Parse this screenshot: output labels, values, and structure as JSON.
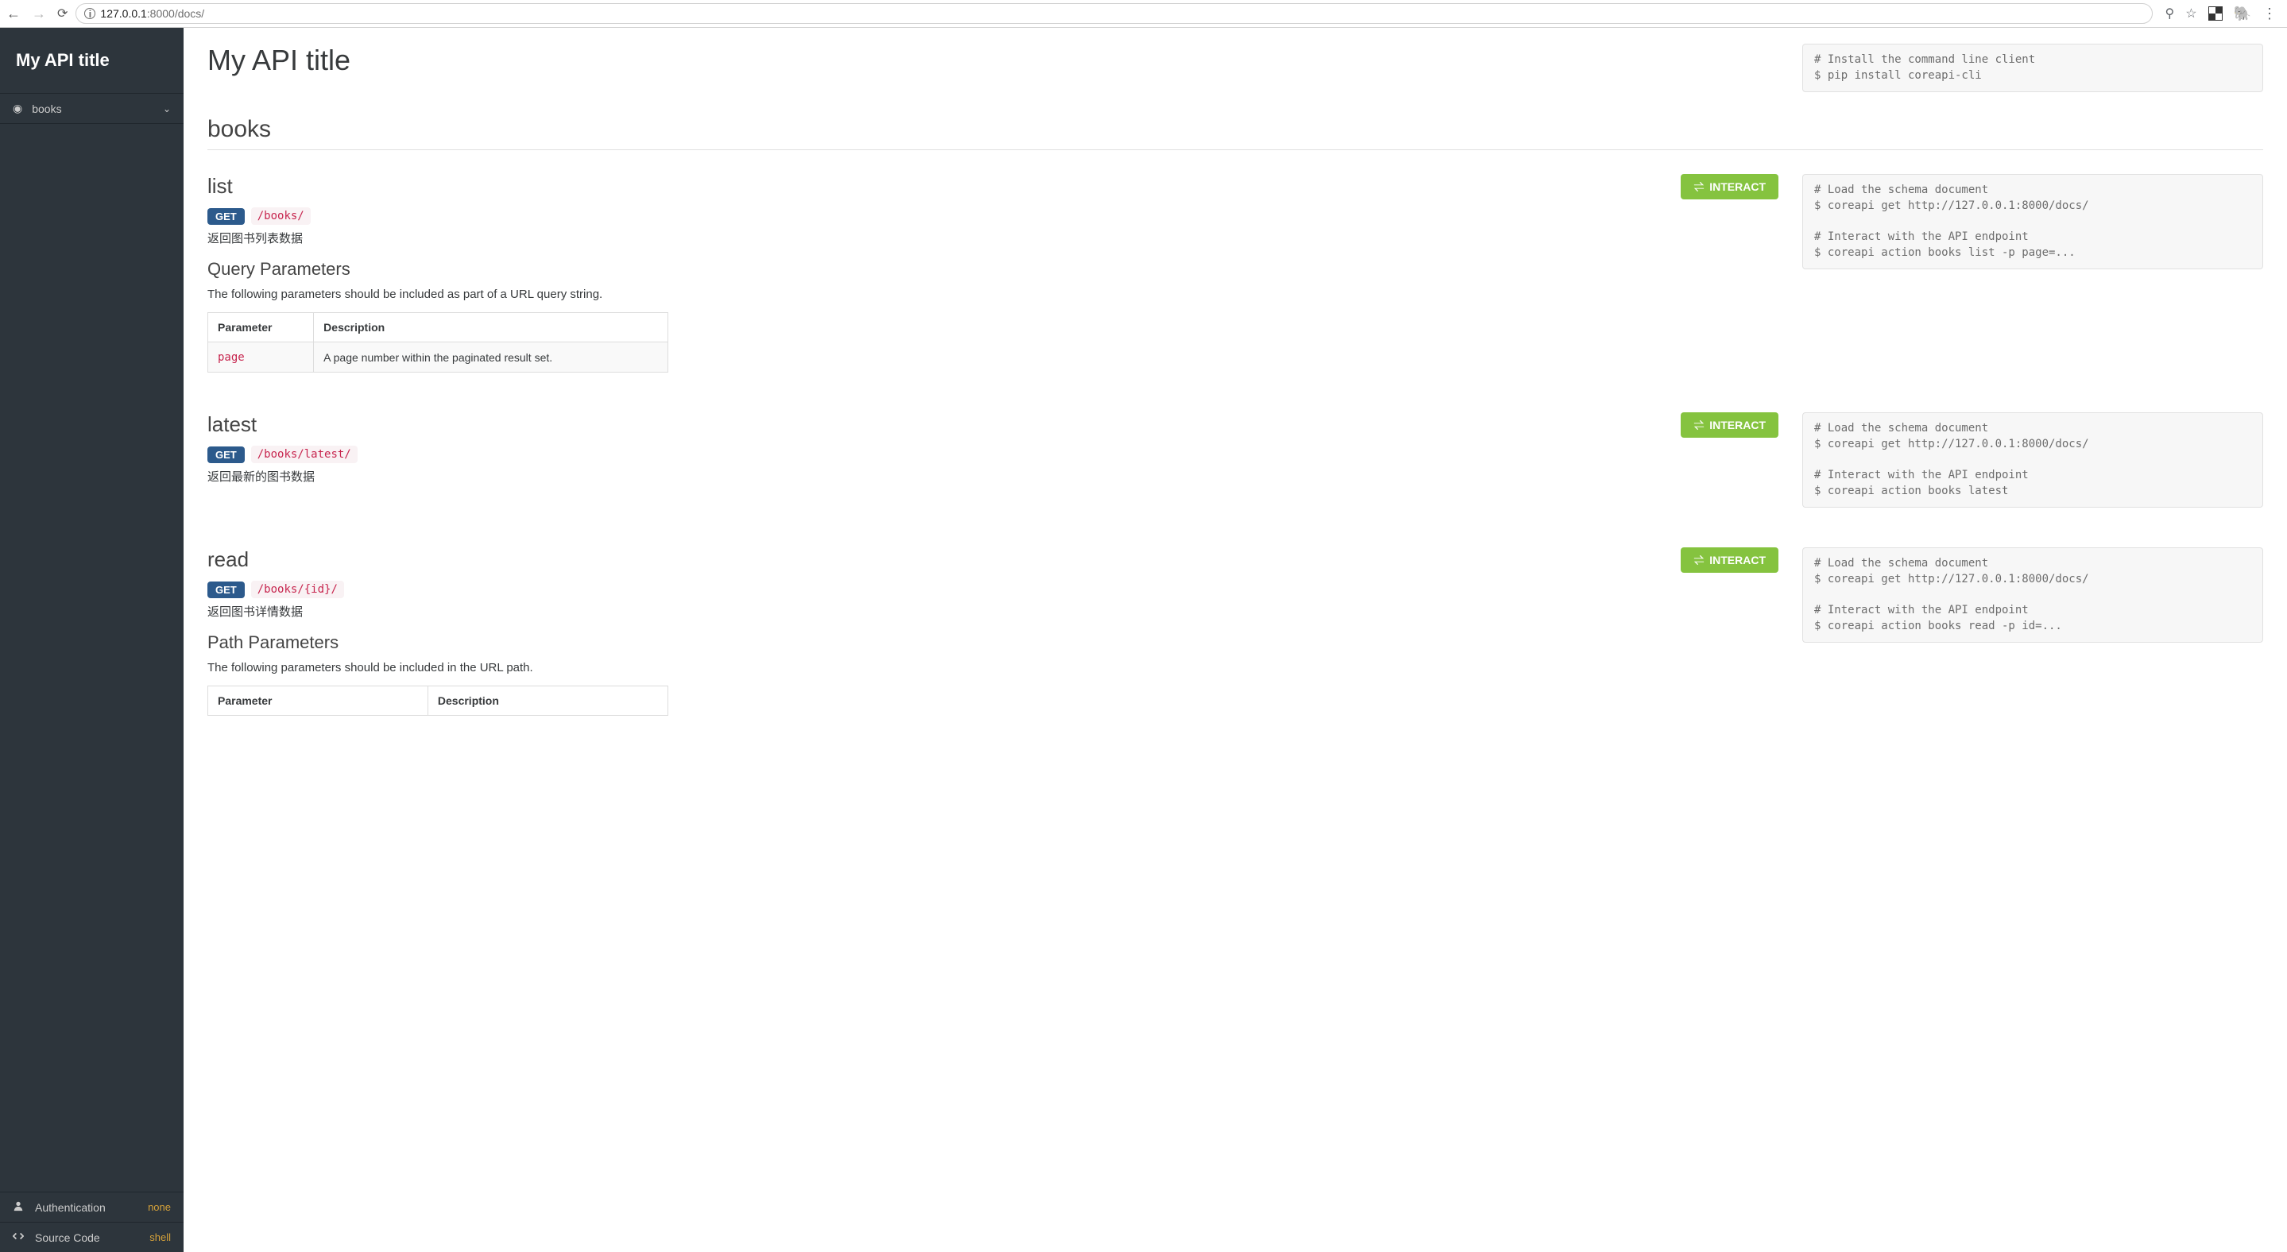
{
  "browser": {
    "url_host": "127.0.0.1",
    "url_port_path": ":8000/docs/"
  },
  "sidebar": {
    "title": "My API title",
    "item": "books",
    "auth_label": "Authentication",
    "auth_value": "none",
    "source_label": "Source Code",
    "source_value": "shell"
  },
  "page": {
    "title": "My API title",
    "install_code": "# Install the command line client\n$ pip install coreapi-cli",
    "section": "books"
  },
  "endpoints": [
    {
      "name": "list",
      "method": "GET",
      "path": "/books/",
      "desc": "返回图书列表数据",
      "interact": "INTERACT",
      "params_heading": "Query Parameters",
      "params_note": "The following parameters should be included as part of a URL query string.",
      "table_h1": "Parameter",
      "table_h2": "Description",
      "param_name": "page",
      "param_desc": "A page number within the paginated result set.",
      "code": "# Load the schema document\n$ coreapi get http://127.0.0.1:8000/docs/\n\n# Interact with the API endpoint\n$ coreapi action books list -p page=..."
    },
    {
      "name": "latest",
      "method": "GET",
      "path": "/books/latest/",
      "desc": "返回最新的图书数据",
      "interact": "INTERACT",
      "code": "# Load the schema document\n$ coreapi get http://127.0.0.1:8000/docs/\n\n# Interact with the API endpoint\n$ coreapi action books latest"
    },
    {
      "name": "read",
      "method": "GET",
      "path": "/books/{id}/",
      "desc": "返回图书详情数据",
      "interact": "INTERACT",
      "params_heading": "Path Parameters",
      "params_note": "The following parameters should be included in the URL path.",
      "table_h1": "Parameter",
      "table_h2": "Description",
      "code": "# Load the schema document\n$ coreapi get http://127.0.0.1:8000/docs/\n\n# Interact with the API endpoint\n$ coreapi action books read -p id=..."
    }
  ]
}
